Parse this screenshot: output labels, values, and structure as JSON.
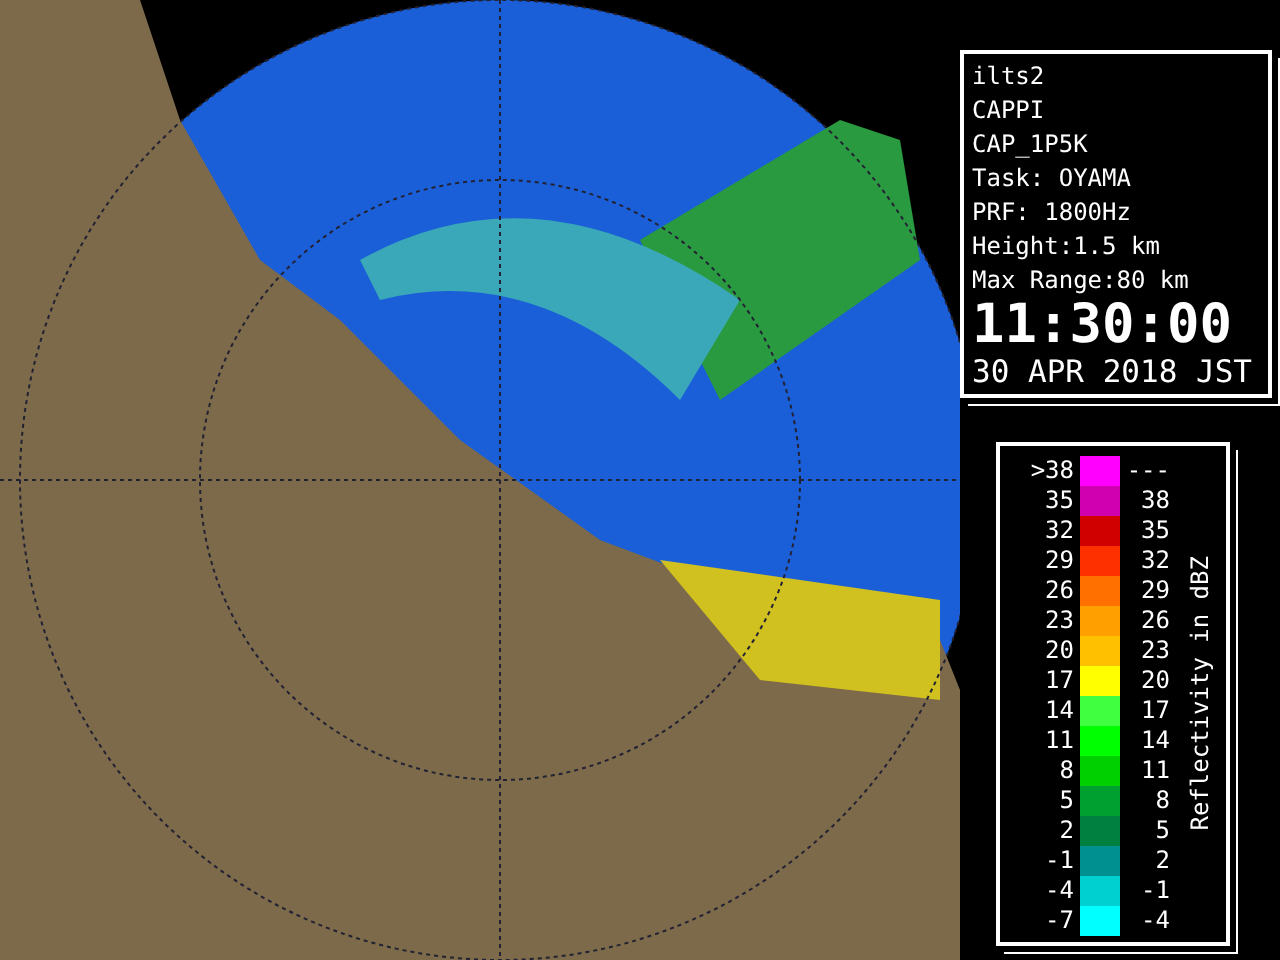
{
  "info_panel": {
    "lines": [
      "ilts2",
      "CAPPI",
      "CAP_1P5K",
      "Task: OYAMA",
      "PRF: 1800Hz",
      "Height:1.5 km",
      "Max Range:80 km"
    ],
    "time": "11:30:00",
    "date": "30 APR 2018 JST"
  },
  "legend": {
    "title": "Reflectivity in dBZ",
    "rows": [
      {
        "low": ">38",
        "high": "---",
        "color": "#ff00ff"
      },
      {
        "low": "35",
        "high": "38",
        "color": "#d000b0"
      },
      {
        "low": "32",
        "high": "35",
        "color": "#d00000"
      },
      {
        "low": "29",
        "high": "32",
        "color": "#ff3000"
      },
      {
        "low": "26",
        "high": "29",
        "color": "#ff7000"
      },
      {
        "low": "23",
        "high": "26",
        "color": "#ffa000"
      },
      {
        "low": "20",
        "high": "23",
        "color": "#ffc000"
      },
      {
        "low": "17",
        "high": "20",
        "color": "#ffff00"
      },
      {
        "low": "14",
        "high": "17",
        "color": "#40ff40"
      },
      {
        "low": "11",
        "high": "14",
        "color": "#00ff00"
      },
      {
        "low": "8",
        "high": "11",
        "color": "#00d000"
      },
      {
        "low": "5",
        "high": "8",
        "color": "#00a030"
      },
      {
        "low": "2",
        "high": "5",
        "color": "#008040"
      },
      {
        "low": "-1",
        "high": "2",
        "color": "#009090"
      },
      {
        "low": "-4",
        "high": "-1",
        "color": "#00d0d0"
      },
      {
        "low": "-7",
        "high": "-4",
        "color": "#00ffff"
      }
    ]
  }
}
